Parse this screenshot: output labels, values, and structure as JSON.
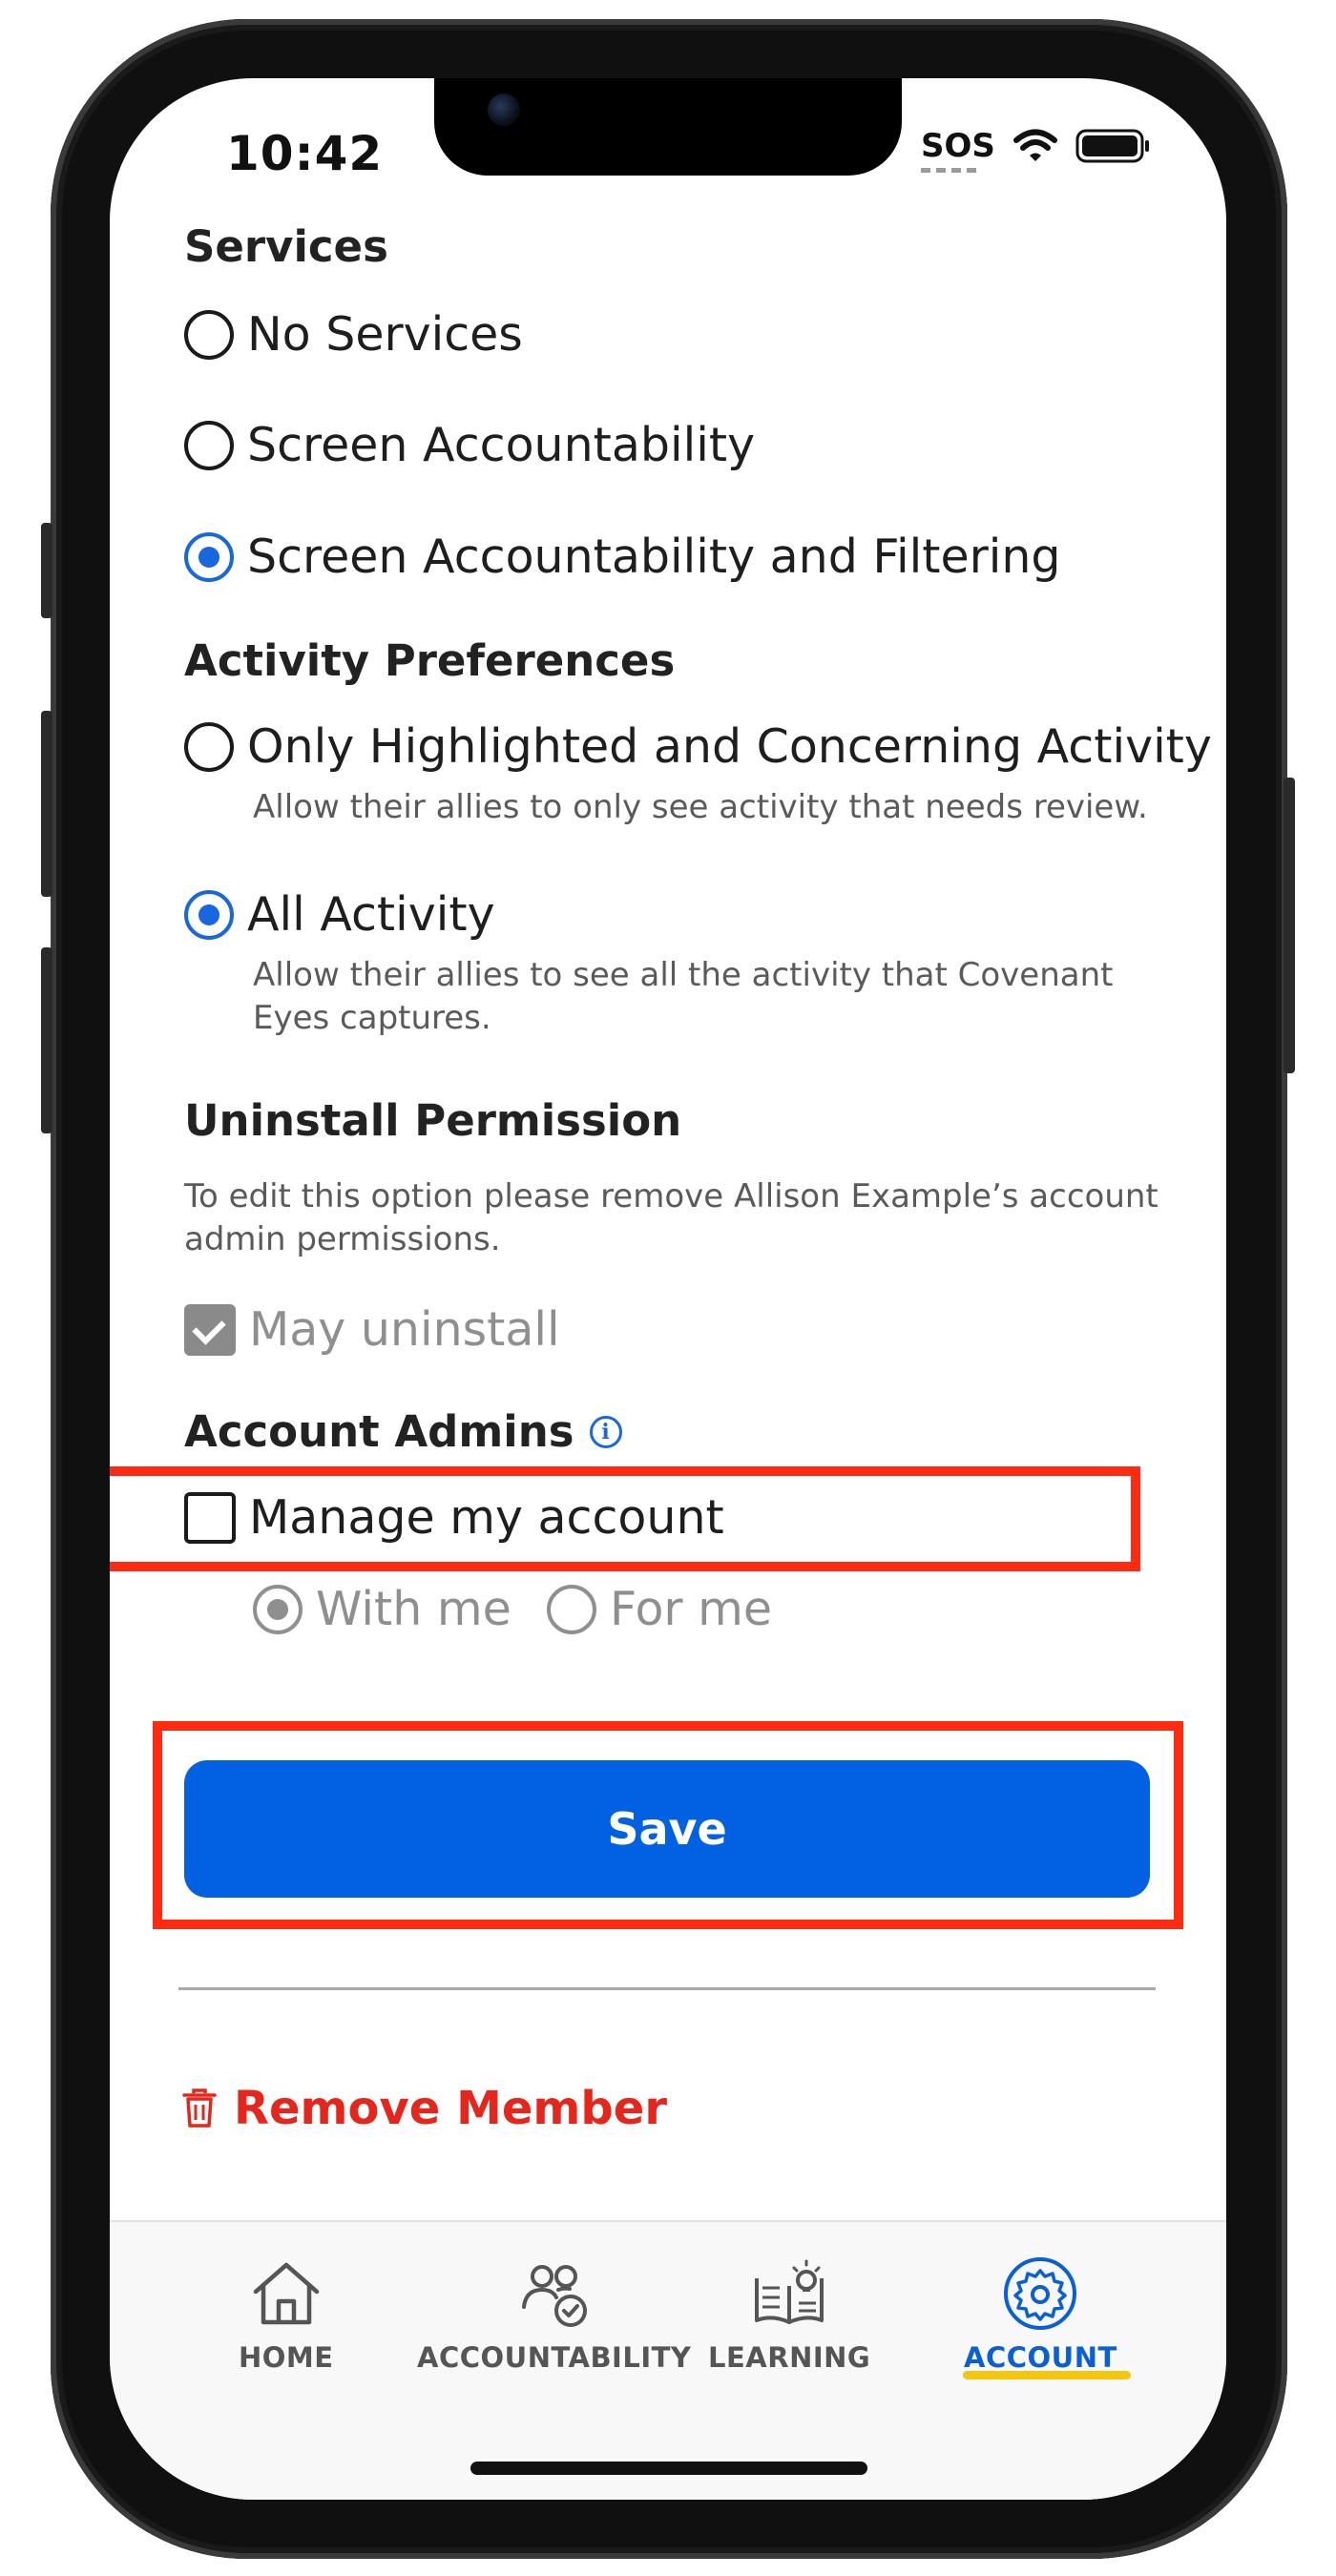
{
  "status_bar": {
    "time": "10:42",
    "sos_label": "SOS"
  },
  "services": {
    "heading": "Services",
    "options": [
      {
        "label": "No Services",
        "selected": false
      },
      {
        "label": "Screen Accountability",
        "selected": false
      },
      {
        "label": "Screen Accountability and Filtering",
        "selected": true
      }
    ]
  },
  "activity_preferences": {
    "heading": "Activity Preferences",
    "options": [
      {
        "label": "Only Highlighted and Concerning Activity",
        "description": "Allow their allies to only see activity that needs review.",
        "selected": false
      },
      {
        "label": "All Activity",
        "description": "Allow their allies to see all the activity that Covenant Eyes captures.",
        "selected": true
      }
    ]
  },
  "uninstall_permission": {
    "heading": "Uninstall Permission",
    "description": "To edit this option please remove Allison Example’s account admin permissions.",
    "checkbox_label": "May uninstall",
    "checked": true,
    "disabled": true
  },
  "account_admins": {
    "heading": "Account Admins",
    "manage_label": "Manage my account",
    "manage_checked": false,
    "sub_options": [
      {
        "label": "With me",
        "selected": true
      },
      {
        "label": "For me",
        "selected": false
      }
    ]
  },
  "save_label": "Save",
  "remove_member_label": "Remove Member",
  "tabs": [
    {
      "label": "HOME",
      "icon": "home-icon",
      "active": false
    },
    {
      "label": "ACCOUNTABILITY",
      "icon": "people-check-icon",
      "active": false
    },
    {
      "label": "LEARNING",
      "icon": "book-lightbulb-icon",
      "active": false
    },
    {
      "label": "ACCOUNT",
      "icon": "gear-icon",
      "active": true
    }
  ],
  "colors": {
    "accent_blue": "#0260e2",
    "danger_red": "#e5261c",
    "highlight_red": "#ff2a12",
    "tab_underline": "#f5c60e"
  }
}
